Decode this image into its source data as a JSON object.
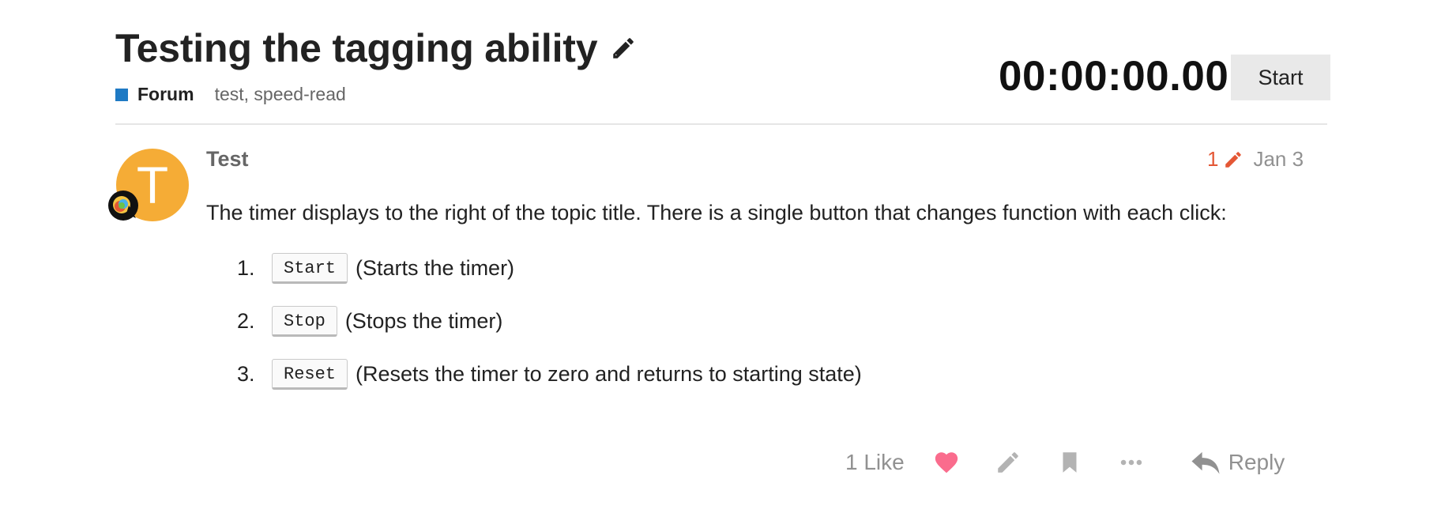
{
  "topic": {
    "title": "Testing the tagging ability",
    "category": "Forum",
    "category_color": "#1f7ac4",
    "tags": "test, speed-read"
  },
  "timer": {
    "display": "00:00:00.00",
    "button_label": "Start"
  },
  "post": {
    "username": "Test",
    "avatar_letter": "T",
    "avatar_color": "#f5ac36",
    "edit_count": "1",
    "date": "Jan 3",
    "body": "The timer displays to the right of the topic title. There is a single button that changes function with each click:",
    "steps": [
      {
        "number": "1.",
        "key": "Start",
        "text": "(Starts the timer)"
      },
      {
        "number": "2.",
        "key": "Stop",
        "text": "(Stops the timer)"
      },
      {
        "number": "3.",
        "key": "Reset",
        "text": "(Resets the timer to zero and returns to starting state)"
      }
    ]
  },
  "actions": {
    "like_count": "1 Like",
    "reply_label": "Reply",
    "icons": [
      "heart-icon",
      "pencil-icon",
      "bookmark-icon",
      "more-icon",
      "reply-icon"
    ]
  }
}
